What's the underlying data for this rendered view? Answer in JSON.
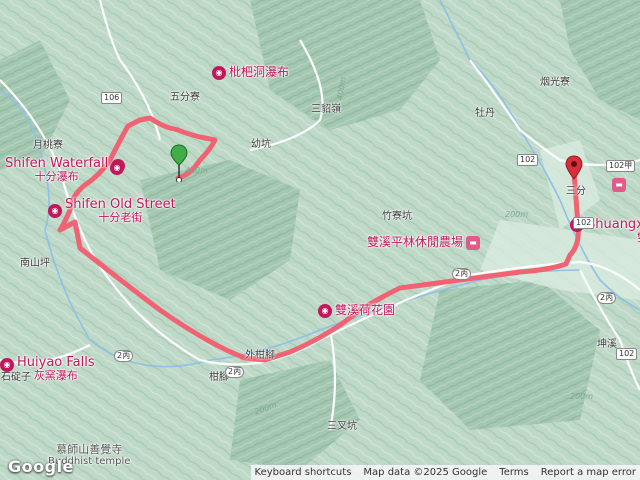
{
  "map": {
    "labels": {
      "yuetaoliao": "月桃寮",
      "wufenliao": "五分寮",
      "sanbaoling": "三貂嶺",
      "youkeng": "幼坑",
      "mudan": "牡丹",
      "jinguangliao": "烟光寮",
      "zhuliaokeng": "竹寮坑",
      "nanshanping": "南山坪",
      "gandiao": "柑腳",
      "sanchakeng": "三叉坑",
      "shikeng": "石碇子",
      "kunxi": "坤溪",
      "sanfen": "三分",
      "waitaijiao": "外柑腳"
    },
    "pois": {
      "pipa_waterfall": "枇杷洞瀑布",
      "shifen_waterfall_en": "Shifen Waterfall",
      "shifen_waterfall_zh": "十分瀑布",
      "shifen_old_street_en": "Shifen Old Street",
      "shifen_old_street_zh": "十分老街",
      "shuangxi_farm": "雙溪平林休閒農場",
      "shuangxi_lotus": "雙溪荷花園",
      "huiyao_en": "Huiyao Falls",
      "huiyao_zh": "灰窯瀑布",
      "shuangxi_en": "Shuangxi",
      "shuangxi_zh": "雙溪",
      "temple_zh": "慕師山善覺寺",
      "temple_en": "Buddhist temple"
    },
    "roads": {
      "r106": "106",
      "r102": "102",
      "r102a": "102甲",
      "r102b": "102",
      "r2c_a": "2丙",
      "r2c_b": "2丙",
      "r2c_c": "2丙",
      "r2c_d": "2丙",
      "r102c": "102",
      "r106_b": "106"
    },
    "contours": {
      "c1": "200m",
      "c2": "400m",
      "c3": "200m",
      "c4": "200m",
      "c5": "400m"
    },
    "route_color": "#f06373",
    "start_marker_color": "#3fae49",
    "end_marker_color": "#d92f3a"
  },
  "logo": "Google",
  "attribution": {
    "shortcuts": "Keyboard shortcuts",
    "data": "Map data ©2025 Google",
    "terms": "Terms",
    "report": "Report a map error"
  }
}
